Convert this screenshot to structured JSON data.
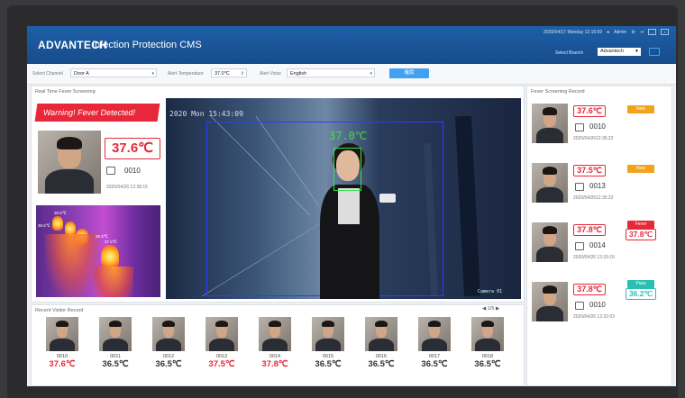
{
  "header": {
    "logo": "ADVANTECH",
    "title": "Infection Protection CMS",
    "datetime": "2020/04/17 Monday 12:16:59",
    "user": "Admin",
    "branch_label": "Select Branch",
    "branch_value": "Advantech"
  },
  "toolbar": {
    "channel_label": "Select Channel",
    "channel_value": "Door A",
    "alert_temp_label": "Alert Temperature",
    "alert_temp_value": "37.0℃",
    "alert_voice_label": "Alert Voice",
    "alert_voice_value": "English",
    "query_button": "確認"
  },
  "realtime": {
    "title": "Real Time Fever Screening",
    "warning": "Warning! Fever Detected!",
    "temp": "37.6℃",
    "id": "0010",
    "datetime": "2020/04/26  12:38:15",
    "thermal_labels": [
      "36.5℃",
      "36.5℃",
      "36.5℃",
      "37.5℃"
    ],
    "camera_time": "2020 Mon 15:43:09",
    "camera_temp": "37.0℃",
    "camera_name": "Camera 01"
  },
  "fever_record": {
    "title": "Fever Screening Record",
    "items": [
      {
        "temp": "37.6℃",
        "badge": "New",
        "badge_color": "#f3a21c",
        "id": "0010",
        "datetime": "2020/04/2612:35:22",
        "second_temp": ""
      },
      {
        "temp": "37.5℃",
        "badge": "New",
        "badge_color": "#f3a21c",
        "id": "0013",
        "datetime": "2020/04/2612:35:22",
        "second_temp": ""
      },
      {
        "temp": "37.8℃",
        "badge": "Fever",
        "badge_color": "#e8283a",
        "id": "0014",
        "datetime": "2020/04/26  12:33:15",
        "second_temp": "37.8℃"
      },
      {
        "temp": "37.8℃",
        "badge": "Pass",
        "badge_color": "#2bbfb4",
        "id": "0010",
        "datetime": "2020/04/26  12:32:03",
        "second_temp": "36.2℃"
      }
    ]
  },
  "recent": {
    "title": "Recent Visitor Record",
    "pager": "1/5",
    "items": [
      {
        "id": "0010",
        "temp": "37.6℃",
        "fever": true
      },
      {
        "id": "0011",
        "temp": "36.5℃",
        "fever": false
      },
      {
        "id": "0012",
        "temp": "36.5℃",
        "fever": false
      },
      {
        "id": "0013",
        "temp": "37.5℃",
        "fever": true
      },
      {
        "id": "0014",
        "temp": "37.8℃",
        "fever": true
      },
      {
        "id": "0015",
        "temp": "36.5℃",
        "fever": false
      },
      {
        "id": "0016",
        "temp": "36.5℃",
        "fever": false
      },
      {
        "id": "0017",
        "temp": "36.5℃",
        "fever": false
      },
      {
        "id": "0018",
        "temp": "36.5℃",
        "fever": false
      }
    ]
  },
  "colors": {
    "header": "#1a5599",
    "fever": "#e8283a",
    "normal": "#333333",
    "accent": "#3fa1f0"
  }
}
